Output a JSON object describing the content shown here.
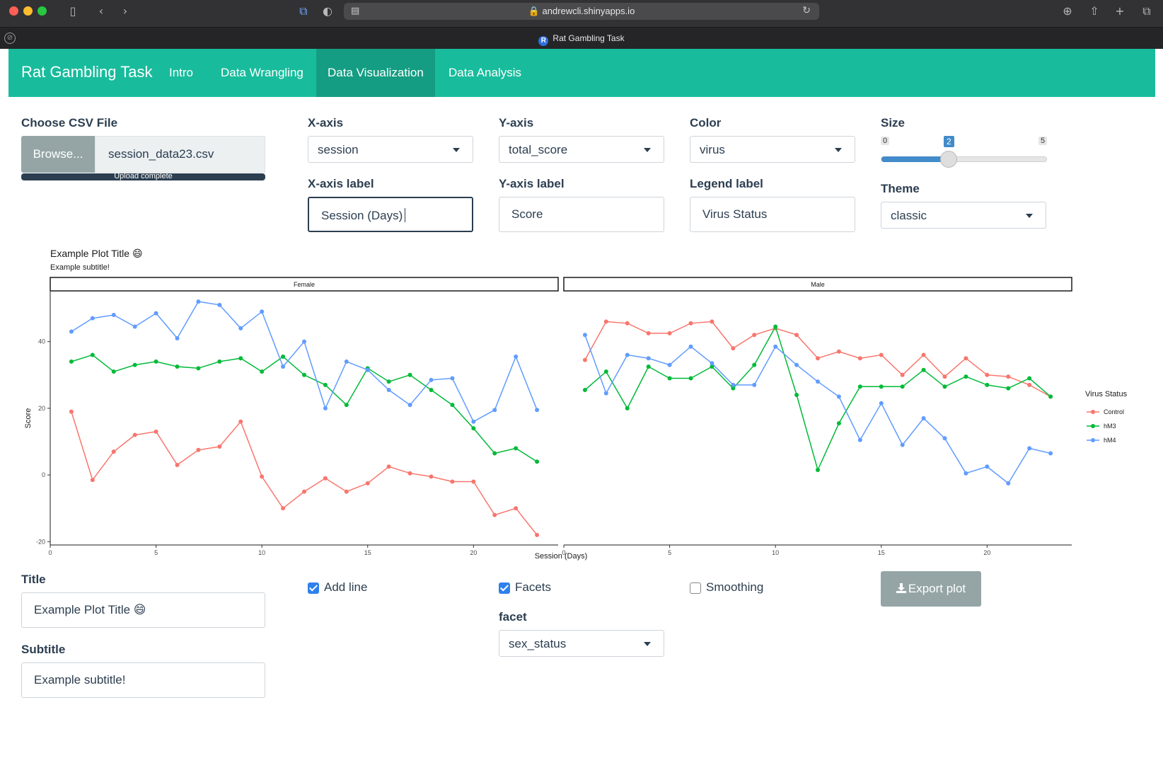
{
  "browser": {
    "url": "andrewcli.shinyapps.io",
    "tab_title": "Rat Gambling Task",
    "tab_favicon": "R"
  },
  "navbar": {
    "brand": "Rat Gambling Task",
    "tabs": [
      "Intro",
      "Data Wrangling",
      "Data Visualization",
      "Data Analysis"
    ],
    "active_tab": "Data Visualization",
    "color": "#18bc9c"
  },
  "file": {
    "label": "Choose CSV File",
    "button": "Browse...",
    "filename": "session_data23.csv",
    "progress_text": "Upload complete",
    "progress": 1.0
  },
  "xaxis": {
    "label": "X-axis",
    "value": "session"
  },
  "yaxis": {
    "label": "Y-axis",
    "value": "total_score"
  },
  "color": {
    "label": "Color",
    "value": "virus"
  },
  "size": {
    "label": "Size",
    "min": "0",
    "max": "5",
    "value": "2"
  },
  "xlabel_field": {
    "label": "X-axis label",
    "value": "Session (Days)"
  },
  "ylabel_field": {
    "label": "Y-axis label",
    "value": "Score"
  },
  "legend_field": {
    "label": "Legend label",
    "value": "Virus Status"
  },
  "theme": {
    "label": "Theme",
    "value": "classic"
  },
  "title_field": {
    "label": "Title",
    "value": "Example Plot Title 😄"
  },
  "subtitle_field": {
    "label": "Subtitle",
    "value": "Example subtitle!"
  },
  "checks": {
    "add_line": {
      "label": "Add line",
      "checked": true
    },
    "facets": {
      "label": "Facets",
      "checked": true
    },
    "smoothing": {
      "label": "Smoothing",
      "checked": false
    }
  },
  "facet": {
    "label": "facet",
    "value": "sex_status"
  },
  "export": {
    "label": "Export plot"
  },
  "chart_data": {
    "type": "line",
    "title": "Example Plot Title 😄",
    "subtitle": "Example subtitle!",
    "xlabel": "Session (Days)",
    "ylabel": "Score",
    "legend_title": "Virus Status",
    "legend_position": "right",
    "xlim": [
      0,
      24
    ],
    "ylim": [
      -21,
      55
    ],
    "xticks": [
      0,
      5,
      10,
      15,
      20
    ],
    "yticks": [
      -20,
      0,
      20,
      40
    ],
    "grid": false,
    "facets": [
      {
        "name": "Female",
        "series": [
          {
            "name": "Control",
            "color": "#f8766d",
            "x": [
              1,
              2,
              3,
              4,
              5,
              6,
              7,
              8,
              9,
              10,
              11,
              12,
              13,
              14,
              15,
              16,
              17,
              18,
              19,
              20,
              21,
              22,
              23
            ],
            "values": [
              19,
              -1.5,
              7,
              12,
              13,
              3,
              7.5,
              8.5,
              16,
              -0.5,
              -10,
              -5,
              -1,
              -5,
              -2.5,
              2.5,
              0.5,
              -0.5,
              -2,
              -2,
              -12,
              -10,
              -18
            ]
          },
          {
            "name": "hM3",
            "color": "#00ba38",
            "x": [
              1,
              2,
              3,
              4,
              5,
              6,
              7,
              8,
              9,
              10,
              11,
              12,
              13,
              14,
              15,
              16,
              17,
              18,
              19,
              20,
              21,
              22,
              23
            ],
            "values": [
              34,
              36,
              31,
              33,
              34,
              32.5,
              32,
              34,
              35,
              31,
              35.5,
              30,
              27,
              21,
              32,
              28,
              30,
              25.5,
              21,
              14,
              6.5,
              8,
              4
            ]
          },
          {
            "name": "hM4",
            "color": "#619cff",
            "x": [
              1,
              2,
              3,
              4,
              5,
              6,
              7,
              8,
              9,
              10,
              11,
              12,
              13,
              14,
              15,
              16,
              17,
              18,
              19,
              20,
              21,
              22,
              23
            ],
            "values": [
              43,
              47,
              48,
              44.5,
              48.5,
              41,
              52,
              51,
              44,
              49,
              32.5,
              40,
              20,
              34,
              31.5,
              25.5,
              21,
              28.5,
              29,
              16,
              19.5,
              35.5,
              19.5
            ]
          }
        ]
      },
      {
        "name": "Male",
        "series": [
          {
            "name": "Control",
            "color": "#f8766d",
            "x": [
              1,
              2,
              3,
              4,
              5,
              6,
              7,
              8,
              9,
              10,
              11,
              12,
              13,
              14,
              15,
              16,
              17,
              18,
              19,
              20,
              21,
              22,
              23
            ],
            "values": [
              34.5,
              46,
              45.5,
              42.5,
              42.5,
              45.5,
              46,
              38,
              42,
              44,
              42,
              35,
              37,
              35,
              36,
              30,
              36,
              29.5,
              35,
              30,
              29.5,
              27,
              23.5
            ]
          },
          {
            "name": "hM3",
            "color": "#00ba38",
            "x": [
              1,
              2,
              3,
              4,
              5,
              6,
              7,
              8,
              9,
              10,
              11,
              12,
              13,
              14,
              15,
              16,
              17,
              18,
              19,
              20,
              21,
              22,
              23
            ],
            "values": [
              25.5,
              31,
              20,
              32.5,
              29,
              29,
              32.5,
              26,
              33,
              44.5,
              24,
              1.5,
              15.5,
              26.5,
              26.5,
              26.5,
              31.5,
              26.5,
              29.5,
              27,
              26,
              29,
              23.5
            ]
          },
          {
            "name": "hM4",
            "color": "#619cff",
            "x": [
              1,
              2,
              3,
              4,
              5,
              6,
              7,
              8,
              9,
              10,
              11,
              12,
              13,
              14,
              15,
              16,
              17,
              18,
              19,
              20,
              21,
              22,
              23
            ],
            "values": [
              42,
              24.5,
              36,
              35,
              33,
              38.5,
              33.5,
              27,
              27,
              38.5,
              33,
              28,
              23.5,
              10.5,
              21.5,
              9,
              17,
              11,
              0.5,
              2.5,
              -2.5,
              8,
              6.5
            ]
          }
        ]
      }
    ]
  }
}
